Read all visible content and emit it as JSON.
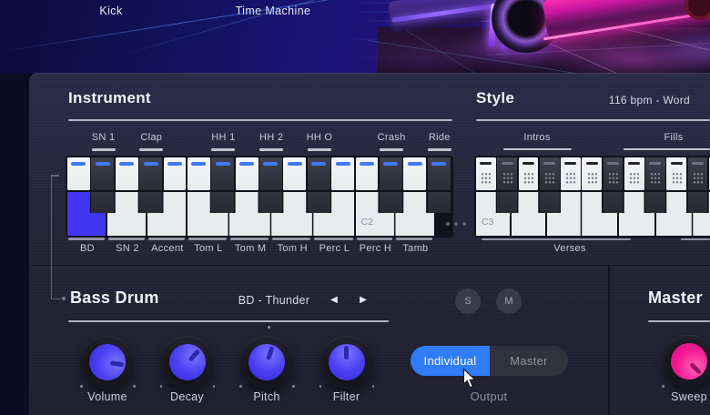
{
  "topbar": {
    "left_label": "Kick",
    "right_label": "Time Machine"
  },
  "instrument": {
    "title": "Instrument",
    "keys": [
      {
        "note": "C1",
        "type": "white",
        "drum": "BD",
        "selected": true
      },
      {
        "note": "C#1",
        "type": "black",
        "drum": "SN 1"
      },
      {
        "note": "D1",
        "type": "white",
        "drum": "SN 2"
      },
      {
        "note": "D#1",
        "type": "black",
        "drum": "Clap"
      },
      {
        "note": "E1",
        "type": "white",
        "drum": "Accent"
      },
      {
        "note": "F1",
        "type": "white",
        "drum": "Tom L"
      },
      {
        "note": "F#1",
        "type": "black",
        "drum": "HH 1"
      },
      {
        "note": "G1",
        "type": "white",
        "drum": "Tom M"
      },
      {
        "note": "G#1",
        "type": "black",
        "drum": "HH 2"
      },
      {
        "note": "A1",
        "type": "white",
        "drum": "Tom H"
      },
      {
        "note": "A#1",
        "type": "black",
        "drum": "HH O"
      },
      {
        "note": "B1",
        "type": "white",
        "drum": "Perc L"
      },
      {
        "note": "C2",
        "type": "white",
        "drum": "Perc H",
        "note_label": "C2"
      },
      {
        "note": "C#2",
        "type": "black",
        "drum": "Crash"
      },
      {
        "note": "D2",
        "type": "white",
        "drum": "Tamb"
      },
      {
        "note": "D#2",
        "type": "black",
        "drum": "Ride"
      }
    ],
    "more_indicator_icon": "more-keys-dots"
  },
  "style": {
    "title": "Style",
    "tempo_style": "116 bpm - Word",
    "top_groups": [
      {
        "label": "Intros"
      },
      {
        "label": "Fills"
      }
    ],
    "bottom_groups": [
      {
        "label": "Verses"
      },
      {
        "label": ""
      }
    ],
    "keys": [
      {
        "note": "C3",
        "type": "white",
        "note_label": "C3"
      },
      {
        "note": "C#3",
        "type": "black"
      },
      {
        "note": "D3",
        "type": "white"
      },
      {
        "note": "D#3",
        "type": "black"
      },
      {
        "note": "E3",
        "type": "white"
      },
      {
        "note": "F3",
        "type": "white"
      },
      {
        "note": "F#3",
        "type": "black"
      },
      {
        "note": "G3",
        "type": "white"
      },
      {
        "note": "G#3",
        "type": "black"
      },
      {
        "note": "A3",
        "type": "white"
      },
      {
        "note": "A#3",
        "type": "black"
      },
      {
        "note": "B3",
        "type": "white"
      }
    ]
  },
  "edit_section": {
    "title": "Bass Drum",
    "preset": "BD - Thunder",
    "prev_icon": "◀",
    "next_icon": "▶",
    "solo_label": "S",
    "mute_label": "M",
    "knobs": [
      {
        "label": "Volume",
        "angle": 97
      },
      {
        "label": "Decay",
        "angle": 42
      },
      {
        "label": "Pitch",
        "angle": 18
      },
      {
        "label": "Filter",
        "angle": 0
      }
    ],
    "output": {
      "options": [
        "Individual",
        "Master"
      ],
      "selected": "Individual",
      "caption": "Output"
    }
  },
  "master_section": {
    "title": "Master",
    "knobs": [
      {
        "label": "Sweep",
        "angle": 135
      }
    ]
  },
  "colors": {
    "accent_blue": "#2f7cf6",
    "selected_key_blue": "#4136f0",
    "key_indicator_blue": "#3f7bf2",
    "knob_blue": "#4a40f2",
    "knob_pink": "#f51a96"
  }
}
